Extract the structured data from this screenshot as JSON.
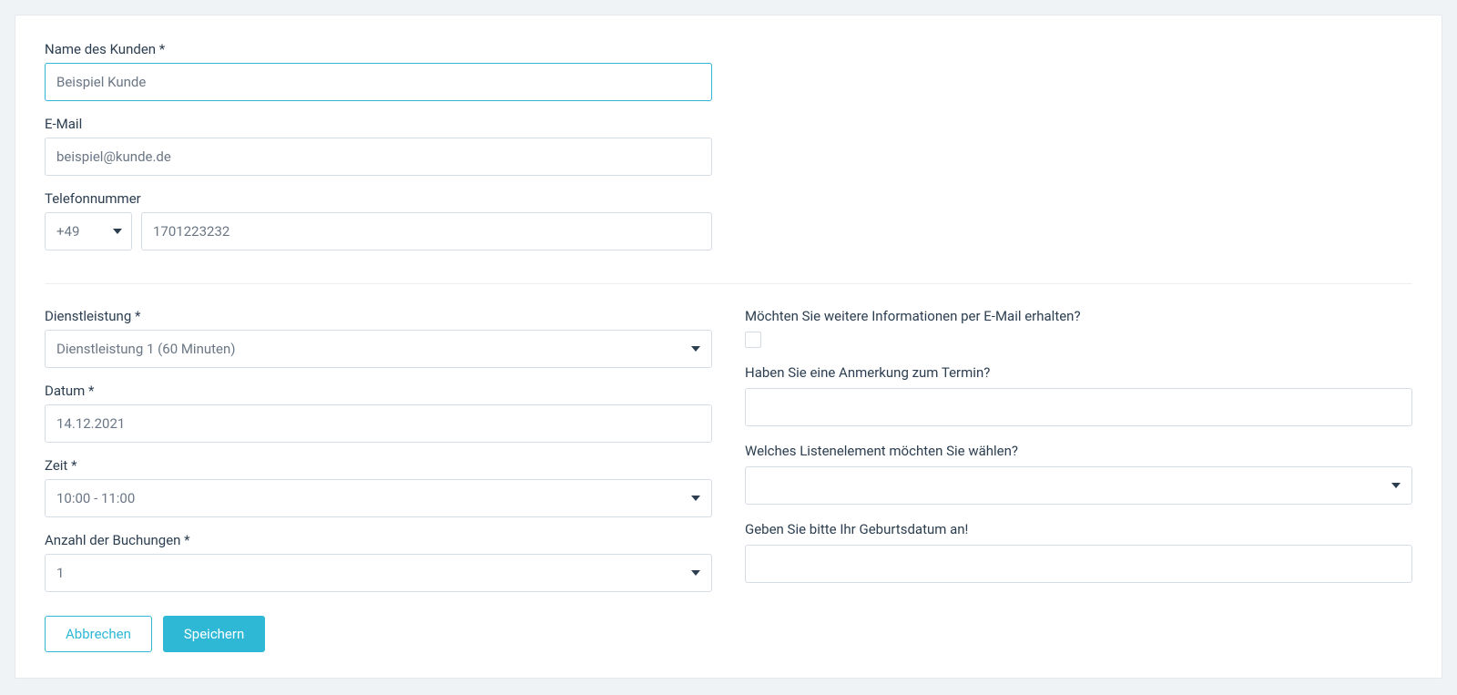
{
  "customer": {
    "name_label": "Name des Kunden *",
    "name_value": "Beispiel Kunde",
    "email_label": "E-Mail",
    "email_value": "beispiel@kunde.de",
    "phone_label": "Telefonnummer",
    "phone_prefix": "+49",
    "phone_value": "1701223232"
  },
  "booking": {
    "service_label": "Dienstleistung *",
    "service_value": "Dienstleistung 1 (60 Minuten)",
    "date_label": "Datum *",
    "date_value": "14.12.2021",
    "time_label": "Zeit *",
    "time_value": "10:00 - 11:00",
    "count_label": "Anzahl der Buchungen *",
    "count_value": "1"
  },
  "questions": {
    "q1": "Möchten Sie weitere Informationen per E-Mail erhalten?",
    "q2": "Haben Sie eine Anmerkung zum Termin?",
    "q2_value": "",
    "q3": "Welches Listenelement möchten Sie wählen?",
    "q3_value": "",
    "q4": "Geben Sie bitte Ihr Geburtsdatum an!",
    "q4_value": ""
  },
  "buttons": {
    "cancel": "Abbrechen",
    "save": "Speichern"
  }
}
